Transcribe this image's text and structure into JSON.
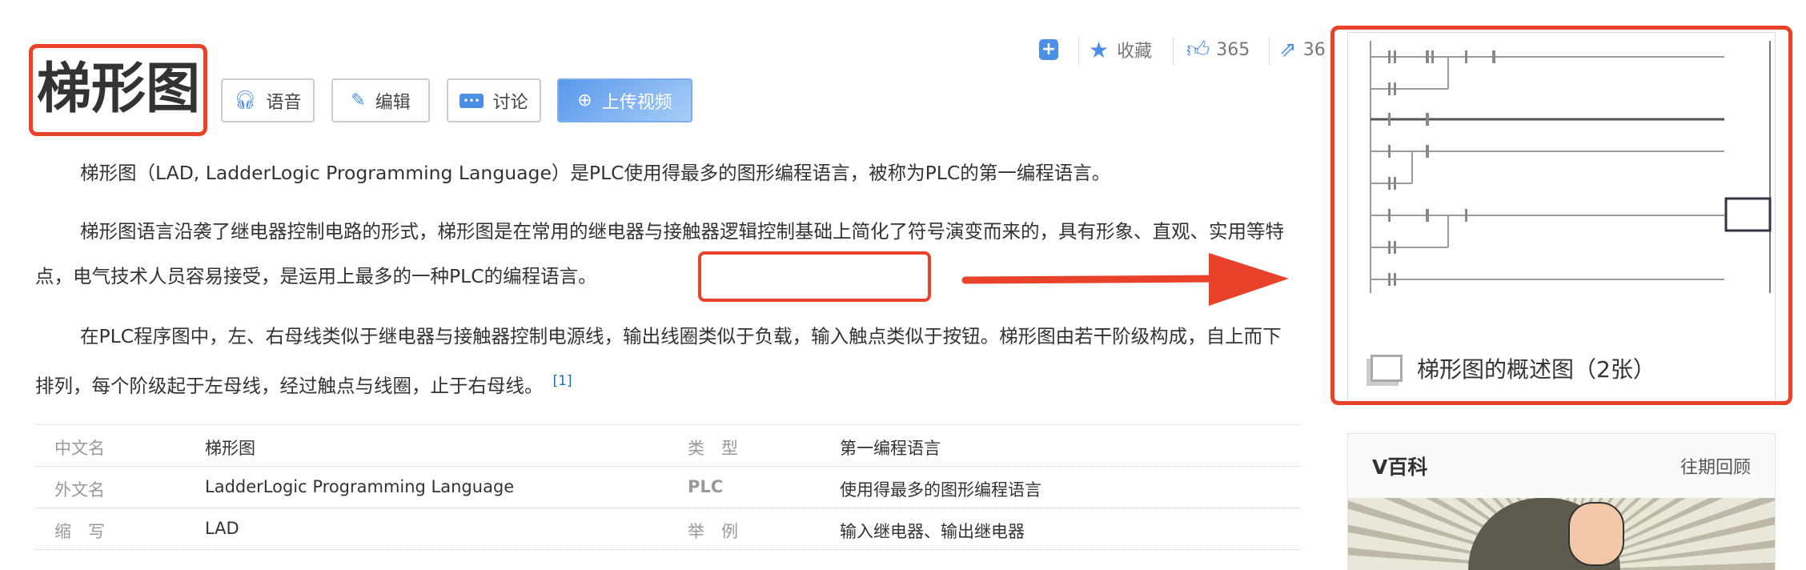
{
  "header": {
    "title": "梯形图",
    "buttons": {
      "voice": "语音",
      "edit": "编辑",
      "discuss": "讨论",
      "upload": "上传视频"
    },
    "actions": {
      "collect": "收藏",
      "likes": "365",
      "shares": "36"
    }
  },
  "paragraphs": [
    "梯形图（LAD, LadderLogic Programming Language）是PLC使用得最多的图形编程语言，被称为PLC的第一编程语言。",
    "梯形图语言沿袭了继电器控制电路的形式，梯形图是在常用的继电器与接触器逻辑控制基础上简化了符号演变而来的，具有形象、直观、实用等特点，电气技术人员容易接受，是运用上最多的一种PLC的编程语言。",
    "在PLC程序图中，左、右母线类似于继电器与接触器控制电源线，输出线圈类似于负载，输入触点类似于按钮。梯形图由若干阶级构成，自上而下排列，每个阶级起于左母线，经过触点与线圈，止于右母线。"
  ],
  "citation": "[1]",
  "infobox": [
    {
      "k1": "中文名",
      "v1": "梯形图",
      "k2": "类　型",
      "v2": "第一编程语言"
    },
    {
      "k1": "外文名",
      "v1": "LadderLogic Programming Language",
      "k2": "PLC",
      "v2": "使用得最多的图形编程语言"
    },
    {
      "k1": "缩　写",
      "v1": "LAD",
      "k2": "举　例",
      "v2": "输入继电器、输出继电器"
    }
  ],
  "sidebar": {
    "image_caption": "梯形图的概述图（2张）",
    "vbaike_title": "V百科",
    "vbaike_more": "往期回顾"
  },
  "colors": {
    "annotation": "#e8432a",
    "accent": "#4c8fe6"
  }
}
